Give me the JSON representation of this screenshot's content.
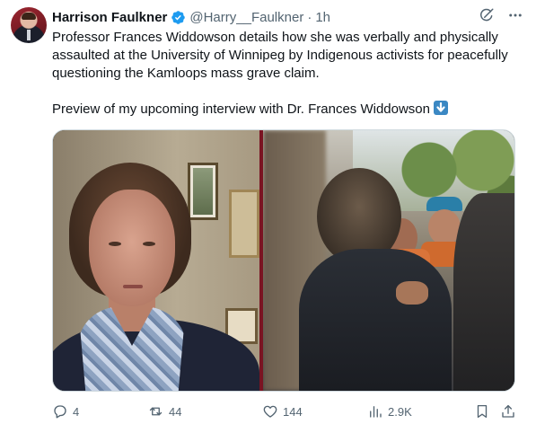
{
  "author": {
    "name": "Harrison Faulkner",
    "handle": "@Harry__Faulkner",
    "separator": "·",
    "time": "1h",
    "verified_color": "#1d9bf0"
  },
  "tweet": {
    "text_para1": "Professor Frances Widdowson details how she was verbally and physically assaulted at the University of Winnipeg by Indigenous activists for peacefully questioning the Kamloops mass grave claim.",
    "text_para2": "Preview of my upcoming interview with Dr. Frances Widdowson",
    "emoji": "down-arrow-emoji"
  },
  "header_icons": [
    "grok-icon",
    "more-options-icon"
  ],
  "media": {
    "left_pane": "interview-video-frame",
    "right_pane": "crowd-video-frame",
    "divider_color": "#7a1422"
  },
  "actions": {
    "reply_count": "4",
    "repost_count": "44",
    "like_count": "144",
    "view_count": "2.9K"
  },
  "colors": {
    "text_primary": "#0f1419",
    "text_secondary": "#536471",
    "accent": "#1d9bf0"
  }
}
